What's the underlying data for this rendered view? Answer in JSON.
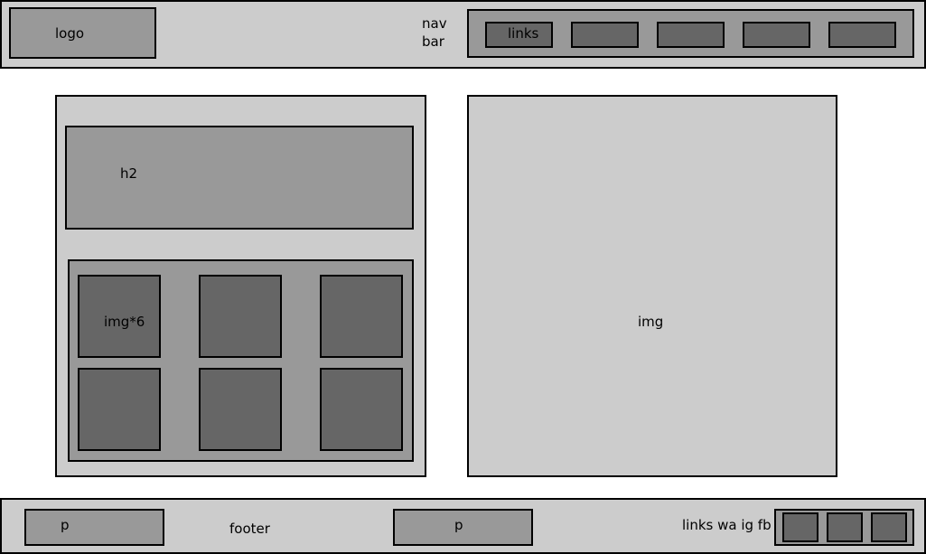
{
  "navbar": {
    "logo_label": "logo",
    "title_line1": "nav",
    "title_line2": "bar",
    "links_label": "links"
  },
  "left_panel": {
    "heading_label": "h2",
    "gallery_label": "img*6"
  },
  "main_image": {
    "label": "img"
  },
  "footer": {
    "paragraph_1_label": "p",
    "footer_label": "footer",
    "paragraph_2_label": "p",
    "social_label": "links wa ig fb"
  },
  "colors": {
    "light_fill": "#cccccc",
    "mid_fill": "#999999",
    "dark_fill": "#666666",
    "border": "#000000",
    "background": "#ffffff"
  }
}
